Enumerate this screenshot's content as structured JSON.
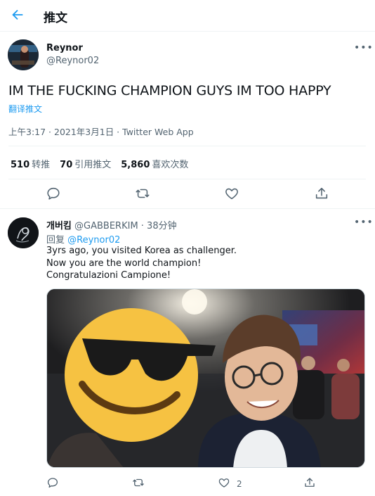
{
  "header": {
    "title": "推文"
  },
  "tweet": {
    "author_name": "Reynor",
    "author_handle": "@Reynor02",
    "text": "IM THE FUCKING CHAMPION GUYS IM TOO HAPPY",
    "translate_label": "翻译推文",
    "meta": "上午3:17 · 2021年3月1日 · Twitter Web App",
    "stats": {
      "retweets_count": "510",
      "retweets_label": "转推",
      "quotes_count": "70",
      "quotes_label": "引用推文",
      "likes_count": "5,860",
      "likes_label": "喜欢次数"
    }
  },
  "reply": {
    "name": "개버킴",
    "handle_time": "@GABBERKIM · 38分钟",
    "replying_prefix": "回复 ",
    "replying_to": "@Reynor02",
    "lines": [
      "3yrs ago, you visited Korea as challenger.",
      "Now you are the world champion!",
      "Congratulazioni Campione!"
    ],
    "like_count": "2"
  },
  "colors": {
    "accent": "#1d9bf0",
    "secondary_text": "#536471",
    "divider": "#eff3f4"
  },
  "icons": {
    "back": "arrow-left-icon",
    "more": "ellipsis-icon",
    "reply": "comment-icon",
    "retweet": "retweet-icon",
    "like": "heart-icon",
    "share": "share-icon"
  }
}
